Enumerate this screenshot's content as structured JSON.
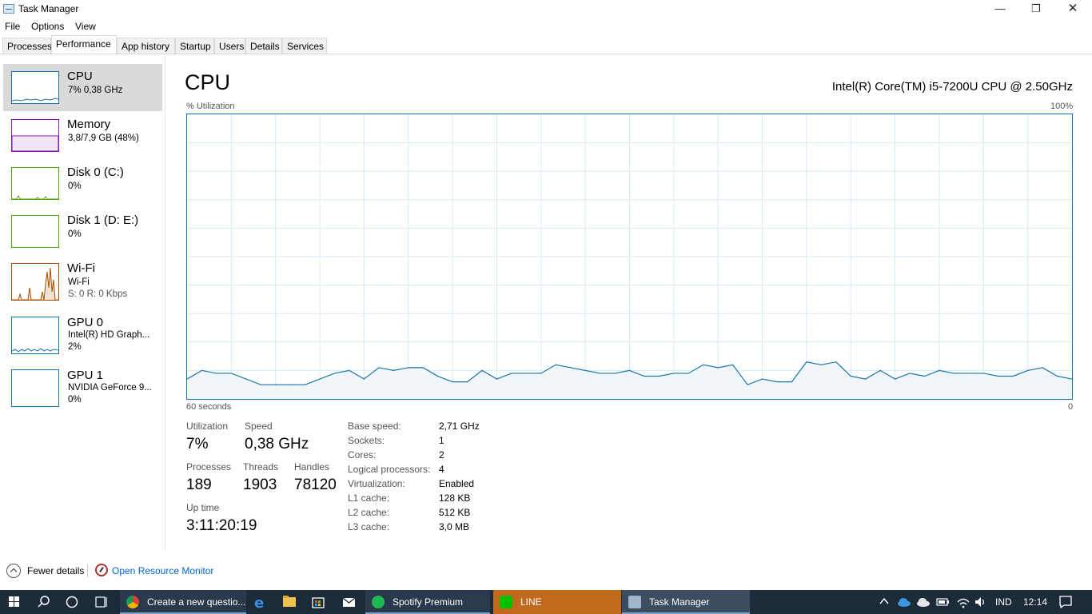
{
  "window": {
    "title": "Task Manager",
    "minimize": "—",
    "maximize": "❐",
    "close": "✕"
  },
  "menu": [
    "File",
    "Options",
    "View"
  ],
  "tabs": [
    "Processes",
    "Performance",
    "App history",
    "Startup",
    "Users",
    "Details",
    "Services"
  ],
  "active_tab": "Performance",
  "devices": [
    {
      "title": "CPU",
      "sub1": "7% 0,38 GHz",
      "sub2": "",
      "color": "#1a76a8"
    },
    {
      "title": "Memory",
      "sub1": "3,8/7,9 GB (48%)",
      "sub2": "",
      "color": "#8b12ae"
    },
    {
      "title": "Disk 0 (C:)",
      "sub1": "0%",
      "sub2": "",
      "color": "#4da60c"
    },
    {
      "title": "Disk 1 (D: E:)",
      "sub1": "0%",
      "sub2": "",
      "color": "#4da60c"
    },
    {
      "title": "Wi-Fi",
      "sub1": "Wi-Fi",
      "sub2": "S: 0 R: 0 Kbps",
      "color": "#a74f01"
    },
    {
      "title": "GPU 0",
      "sub1": "Intel(R) HD Graph...",
      "sub2": "2%",
      "color": "#1a76a8"
    },
    {
      "title": "GPU 1",
      "sub1": "NVIDIA GeForce 9...",
      "sub2": "0%",
      "color": "#1a76a8"
    }
  ],
  "main": {
    "title": "CPU",
    "cpu_name": "Intel(R) Core(TM) i5-7200U CPU @ 2.50GHz",
    "y_label": "% Utilization",
    "y_max": "100%",
    "x_label": "60 seconds",
    "x_min": "0"
  },
  "chart_data": {
    "type": "area",
    "xlabel": "60 seconds",
    "ylabel": "% Utilization",
    "ylim": [
      0,
      100
    ],
    "grid": true,
    "color": "#1a76a8",
    "values": [
      7,
      10,
      9,
      9,
      7,
      5,
      5,
      5,
      5,
      7,
      9,
      10,
      7,
      11,
      10,
      11,
      11,
      8,
      6,
      6,
      10,
      7,
      9,
      9,
      9,
      12,
      11,
      10,
      9,
      9,
      10,
      8,
      8,
      9,
      9,
      12,
      11,
      12,
      5,
      7,
      6,
      6,
      13,
      12,
      13,
      8,
      7,
      10,
      7,
      9,
      8,
      10,
      9,
      9,
      9,
      8,
      8,
      10,
      11,
      8,
      7
    ]
  },
  "stats": {
    "utilization_label": "Utilization",
    "utilization": "7%",
    "speed_label": "Speed",
    "speed": "0,38 GHz",
    "processes_label": "Processes",
    "processes": "189",
    "threads_label": "Threads",
    "threads": "1903",
    "handles_label": "Handles",
    "handles": "78120",
    "uptime_label": "Up time",
    "uptime": "3:11:20:19"
  },
  "info": [
    {
      "label": "Base speed:",
      "value": "2,71 GHz"
    },
    {
      "label": "Sockets:",
      "value": "1"
    },
    {
      "label": "Cores:",
      "value": "2"
    },
    {
      "label": "Logical processors:",
      "value": "4"
    },
    {
      "label": "Virtualization:",
      "value": "Enabled"
    },
    {
      "label": "L1 cache:",
      "value": "128 KB"
    },
    {
      "label": "L2 cache:",
      "value": "512 KB"
    },
    {
      "label": "L3 cache:",
      "value": "3,0 MB"
    }
  ],
  "footer": {
    "fewer_details": "Fewer details",
    "open_resource_monitor": "Open Resource Monitor"
  },
  "taskbar": {
    "chrome": "Create a new questio...",
    "spotify": "Spotify Premium",
    "line": "LINE",
    "task_manager": "Task Manager",
    "lang": "IND",
    "time": "12:14"
  }
}
